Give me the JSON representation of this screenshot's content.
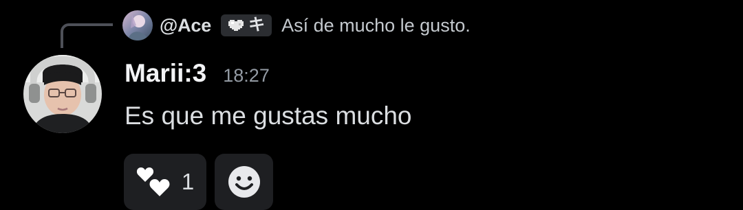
{
  "reply": {
    "author": "@Ace",
    "tag": "キ",
    "text": "Así de mucho le gusto."
  },
  "message": {
    "author": "Marii:3",
    "timestamp": "18:27",
    "text": "Es que me gustas mucho"
  },
  "reactions": [
    {
      "icon": "two-hearts-emoji",
      "count": "1"
    },
    {
      "icon": "add-reaction-smiley"
    }
  ],
  "colors": {
    "background": "#000000",
    "reaction_bg": "#1e1f22",
    "tag_bg": "#2b2d31",
    "muted_text": "#949ba4"
  }
}
